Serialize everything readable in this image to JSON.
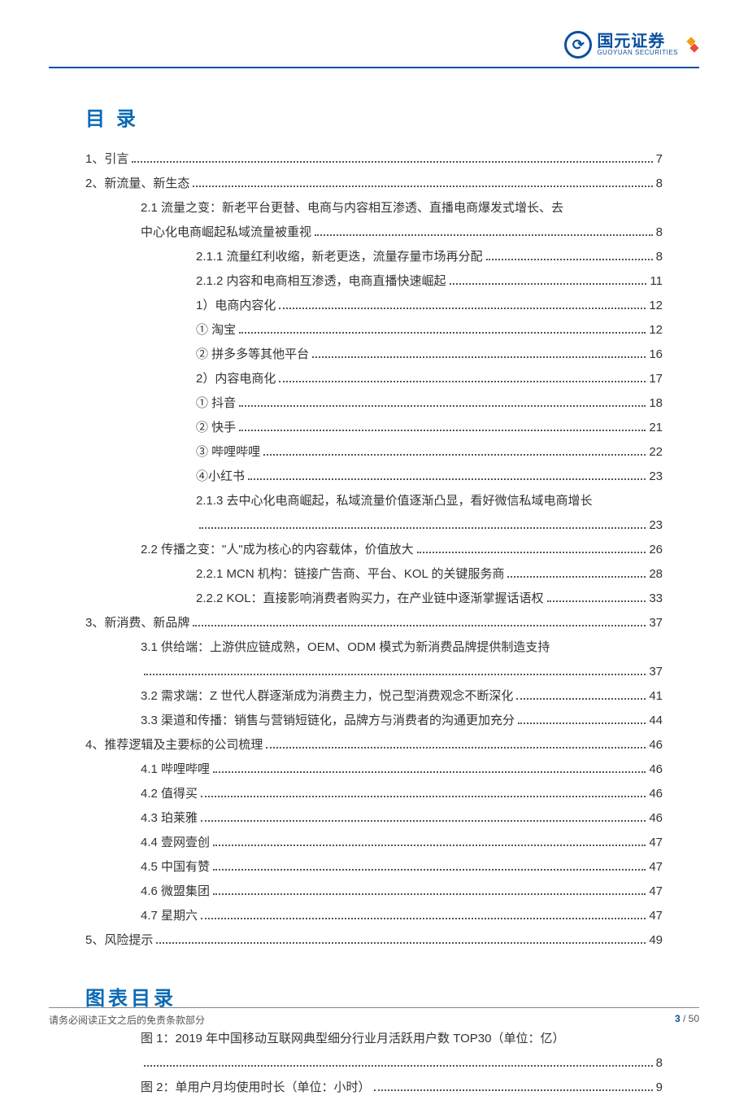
{
  "logo": {
    "cn": "国元证券",
    "en": "GUOYUAN SECURITIES"
  },
  "titles": {
    "toc": "目录",
    "figures": "图表目录"
  },
  "toc": [
    {
      "indent": 0,
      "text": "1、引言",
      "page": "7"
    },
    {
      "indent": 0,
      "text": "2、新流量、新生态",
      "page": "8"
    },
    {
      "indent": 1,
      "text": "2.1 流量之变：新老平台更替、电商与内容相互渗透、直播电商爆发式增长、去",
      "wrap": true
    },
    {
      "indent": 1,
      "cont": true,
      "text": "中心化电商崛起私域流量被重视",
      "page": "8"
    },
    {
      "indent": 2,
      "text": "2.1.1 流量红利收缩，新老更迭，流量存量市场再分配",
      "page": "8"
    },
    {
      "indent": 2,
      "text": "2.1.2 内容和电商相互渗透，电商直播快速崛起",
      "page": "11"
    },
    {
      "indent": 2,
      "text": "1）电商内容化",
      "page": "12"
    },
    {
      "indent": 2,
      "text": "① 淘宝",
      "page": "12"
    },
    {
      "indent": 2,
      "text": "② 拼多多等其他平台",
      "page": "16"
    },
    {
      "indent": 2,
      "text": "2）内容电商化",
      "page": "17"
    },
    {
      "indent": 2,
      "text": "① 抖音",
      "page": "18"
    },
    {
      "indent": 2,
      "text": "② 快手",
      "page": "21"
    },
    {
      "indent": 2,
      "text": "③ 哔哩哔哩",
      "page": "22"
    },
    {
      "indent": 2,
      "text": "④小红书",
      "page": "23"
    },
    {
      "indent": 2,
      "text": "2.1.3 去中心化电商崛起，私域流量价值逐渐凸显，看好微信私域电商增长",
      "wrap": true
    },
    {
      "indent": 2,
      "cont": true,
      "text": "",
      "page": "23"
    },
    {
      "indent": 1,
      "text": "2.2 传播之变：\"人\"成为核心的内容载体，价值放大",
      "page": "26"
    },
    {
      "indent": 2,
      "text": "2.2.1 MCN 机构：链接广告商、平台、KOL 的关键服务商",
      "page": "28"
    },
    {
      "indent": 2,
      "text": "2.2.2 KOL：直接影响消费者购买力，在产业链中逐渐掌握话语权",
      "page": "33"
    },
    {
      "indent": 0,
      "text": "3、新消费、新品牌",
      "page": "37"
    },
    {
      "indent": 1,
      "text": "3.1 供给端：上游供应链成熟，OEM、ODM 模式为新消费品牌提供制造支持",
      "wrap": true
    },
    {
      "indent": 1,
      "cont": true,
      "text": "",
      "page": "37"
    },
    {
      "indent": 1,
      "text": "3.2 需求端：Z 世代人群逐渐成为消费主力，悦己型消费观念不断深化",
      "page": "41"
    },
    {
      "indent": 1,
      "text": "3.3 渠道和传播：销售与营销短链化，品牌方与消费者的沟通更加充分",
      "page": "44"
    },
    {
      "indent": 0,
      "text": "4、推荐逻辑及主要标的公司梳理",
      "page": "46"
    },
    {
      "indent": 1,
      "text": "4.1 哔哩哔哩",
      "page": "46"
    },
    {
      "indent": 1,
      "text": "4.2 值得买",
      "page": "46"
    },
    {
      "indent": 1,
      "text": "4.3 珀莱雅",
      "page": "46"
    },
    {
      "indent": 1,
      "text": "4.4 壹网壹创",
      "page": "47"
    },
    {
      "indent": 1,
      "text": "4.5 中国有赞",
      "page": "47"
    },
    {
      "indent": 1,
      "text": "4.6 微盟集团",
      "page": "47"
    },
    {
      "indent": 1,
      "text": "4.7 星期六",
      "page": "47"
    },
    {
      "indent": 0,
      "text": "5、风险提示",
      "page": "49"
    }
  ],
  "figures": [
    {
      "indent": 1,
      "text": "图 1：2019 年中国移动互联网典型细分行业月活跃用户数 TOP30（单位：亿）",
      "wrap": true
    },
    {
      "indent": 1,
      "cont": true,
      "text": "",
      "page": "8"
    },
    {
      "indent": 1,
      "text": "图 2：单用户月均使用时长（单位：小时）",
      "page": "9"
    }
  ],
  "footer": {
    "disclaimer": "请务必阅读正文之后的免责条款部分",
    "page_current": "3",
    "page_sep": " / ",
    "page_total": "50"
  }
}
